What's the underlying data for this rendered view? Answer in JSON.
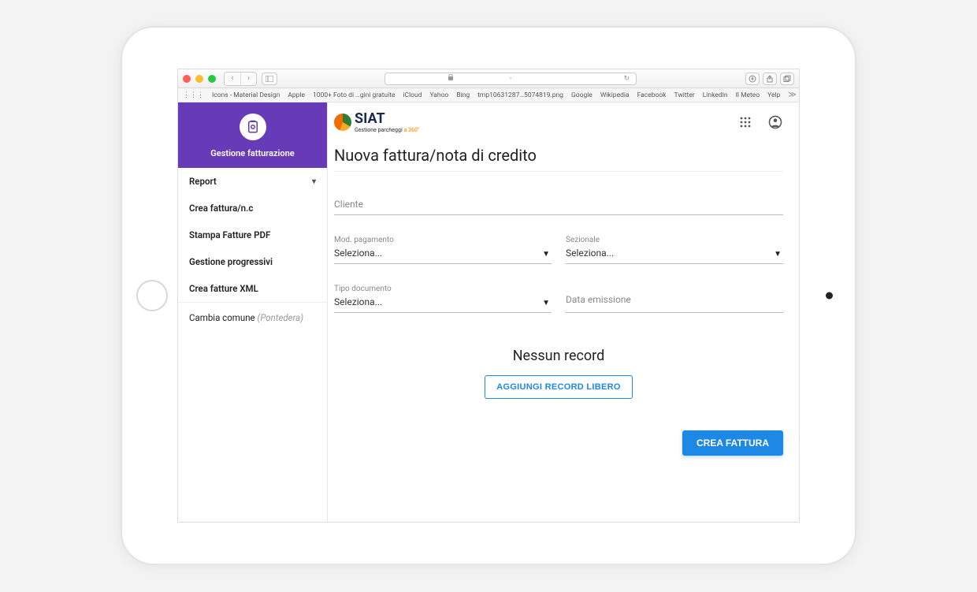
{
  "browser": {
    "url_host": "-",
    "bookmarks": [
      "Icons - Material Design",
      "Apple",
      "1000+ Foto di …gini gratuite",
      "iCloud",
      "Yahoo",
      "Bing",
      "tmp10631287…5074819.png",
      "Google",
      "Wikipedia",
      "Facebook",
      "Twitter",
      "LinkedIn",
      "Il Meteo",
      "Yelp"
    ]
  },
  "logo": {
    "brand": "SIAT",
    "tagline_a": "Gestione parcheggi ",
    "tagline_b": "a 360°"
  },
  "sidebar": {
    "title": "Gestione fatturazione",
    "items": [
      {
        "label": "Report",
        "expandable": true
      },
      {
        "label": "Crea fattura/n.c"
      },
      {
        "label": "Stampa Fatture PDF"
      },
      {
        "label": "Gestione progressivi"
      },
      {
        "label": "Crea fatture XML"
      }
    ],
    "footer_label": "Cambia comune",
    "footer_location": "(Pontedera)"
  },
  "page": {
    "title": "Nuova fattura/nota di credito"
  },
  "form": {
    "cliente_label": "Cliente",
    "mod_pagamento": {
      "label": "Mod. pagamento",
      "value": "Seleziona..."
    },
    "sezionale": {
      "label": "Sezionale",
      "value": "Seleziona..."
    },
    "tipo_documento": {
      "label": "Tipo documento",
      "value": "Seleziona..."
    },
    "data_emissione_label": "Data emissione",
    "empty_text": "Nessun record",
    "add_record_btn": "AGGIUNGI RECORD LIBERO",
    "create_btn": "CREA FATTURA"
  }
}
